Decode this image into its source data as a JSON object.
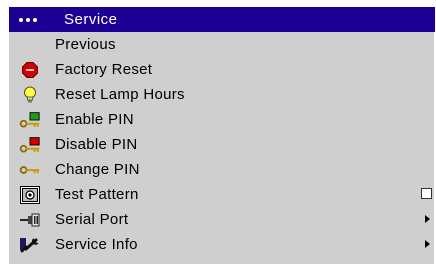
{
  "menu": {
    "title": "Service",
    "items": [
      {
        "label": "Previous",
        "icon": "none"
      },
      {
        "label": "Factory Reset",
        "icon": "stop-octagon-icon"
      },
      {
        "label": "Reset Lamp Hours",
        "icon": "lightbulb-icon"
      },
      {
        "label": "Enable PIN",
        "icon": "key-green-icon"
      },
      {
        "label": "Disable PIN",
        "icon": "key-red-icon"
      },
      {
        "label": "Change PIN",
        "icon": "key-icon"
      },
      {
        "label": "Test Pattern",
        "icon": "test-pattern-icon",
        "control": "checkbox",
        "checked": false
      },
      {
        "label": "Serial Port",
        "icon": "serial-port-icon",
        "control": "submenu-arrow"
      },
      {
        "label": "Service Info",
        "icon": "wrench-icon",
        "control": "submenu-arrow"
      }
    ]
  },
  "colors": {
    "header_bg": "#1c0094",
    "menu_bg": "#cfcfcf"
  }
}
